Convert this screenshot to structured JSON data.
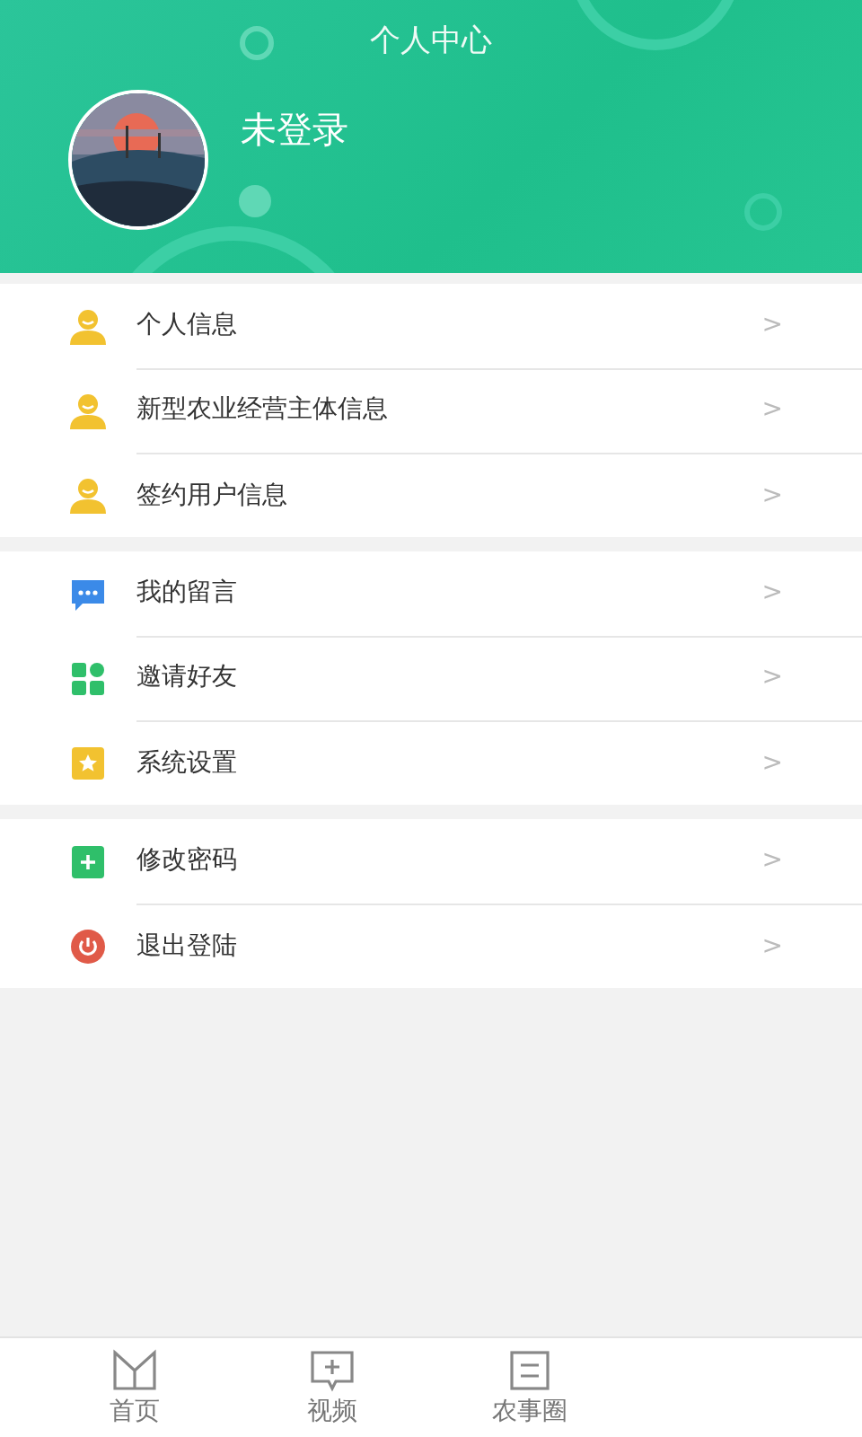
{
  "header": {
    "title": "个人中心",
    "user_name": "未登录"
  },
  "menu_groups": [
    {
      "items": [
        {
          "label": "个人信息",
          "kind": "person",
          "arrow": ">"
        },
        {
          "label": "新型农业经营主体信息",
          "kind": "person",
          "arrow": ">"
        },
        {
          "label": "签约用户信息",
          "kind": "person",
          "arrow": ">"
        }
      ]
    },
    {
      "items": [
        {
          "label": "我的留言",
          "kind": "message",
          "arrow": ">"
        },
        {
          "label": "邀请好友",
          "kind": "grid",
          "arrow": ">"
        },
        {
          "label": "系统设置",
          "kind": "star",
          "arrow": ">"
        }
      ]
    },
    {
      "items": [
        {
          "label": "修改密码",
          "kind": "plus",
          "arrow": ">"
        },
        {
          "label": "退出登陆",
          "kind": "power",
          "arrow": ">"
        }
      ]
    }
  ],
  "tab_bar": [
    {
      "label": "首页",
      "kind": "book"
    },
    {
      "label": "视频",
      "kind": "video"
    },
    {
      "label": "农事圈",
      "kind": "note"
    }
  ]
}
